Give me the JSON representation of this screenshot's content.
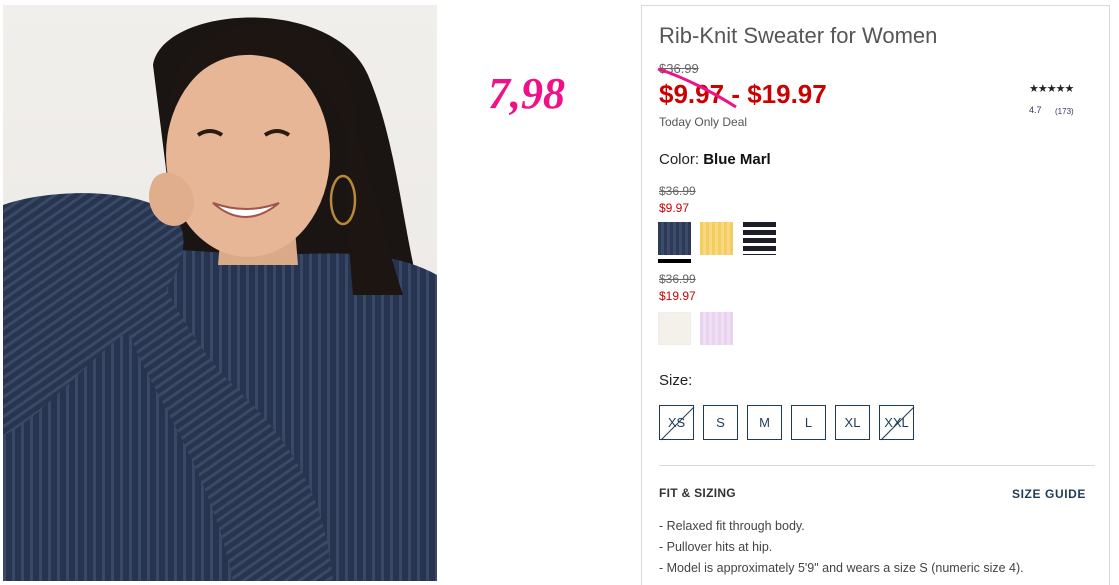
{
  "annotation": "7,98",
  "product": {
    "title": "Rib-Knit Sweater for Women",
    "original_price": "$36.99",
    "sale_price_low": "$9.97",
    "sale_price_separator": " - ",
    "sale_price_high": "$19.97",
    "deal_label": "Today Only Deal",
    "rating_stars": "★★★★★",
    "rating_value": "4.7",
    "review_count": "(173)"
  },
  "color": {
    "label": "Color:",
    "selected": "Blue Marl",
    "groups": [
      {
        "original_price": "$36.99",
        "sale_price": "$9.97",
        "swatches": [
          {
            "name": "Blue Marl",
            "color": "#2c3a55",
            "selected": true
          },
          {
            "name": "Yellow",
            "color": "#f5cc62",
            "selected": false
          },
          {
            "name": "Navy Stripe",
            "color": "#1c1c2a",
            "selected": false
          }
        ]
      },
      {
        "original_price": "$36.99",
        "sale_price": "$19.97",
        "swatches": [
          {
            "name": "Cream",
            "color": "#f3f1ea",
            "selected": false
          },
          {
            "name": "Lavender",
            "color": "#e9d4ef",
            "selected": false
          }
        ]
      }
    ]
  },
  "size": {
    "label": "Size:",
    "options": [
      {
        "label": "XS",
        "available": false
      },
      {
        "label": "S",
        "available": true
      },
      {
        "label": "M",
        "available": true
      },
      {
        "label": "L",
        "available": true
      },
      {
        "label": "XL",
        "available": true
      },
      {
        "label": "XXL",
        "available": false
      }
    ]
  },
  "fit": {
    "heading": "FIT & SIZING",
    "size_guide": "SIZE GUIDE",
    "details": [
      "Relaxed fit through body.",
      "Pullover hits at hip.",
      "Model is approximately 5'9\" and wears a size S (numeric size 4)."
    ]
  },
  "colors": {
    "sale_red": "#cc0000",
    "annotation_pink": "#ee1188",
    "navy": "#1f3c57"
  }
}
